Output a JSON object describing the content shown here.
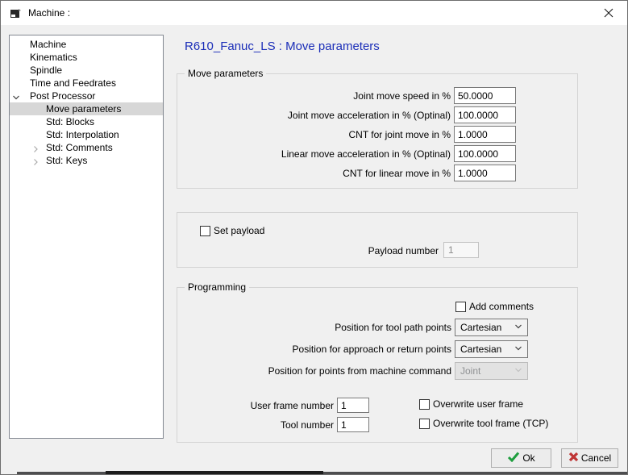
{
  "window": {
    "title": "Machine :",
    "icons": {
      "app": "machine-icon",
      "close": "close-icon"
    }
  },
  "sidebar": {
    "items": [
      {
        "label": "Machine",
        "level": 0,
        "chevron": "none",
        "selected": false
      },
      {
        "label": "Kinematics",
        "level": 0,
        "chevron": "none",
        "selected": false
      },
      {
        "label": "Spindle",
        "level": 0,
        "chevron": "none",
        "selected": false
      },
      {
        "label": "Time and Feedrates",
        "level": 0,
        "chevron": "none",
        "selected": false
      },
      {
        "label": "Post Processor",
        "level": 0,
        "chevron": "down",
        "selected": false
      },
      {
        "label": "Move parameters",
        "level": 1,
        "chevron": "none",
        "selected": true
      },
      {
        "label": "Std: Blocks",
        "level": 1,
        "chevron": "none",
        "selected": false
      },
      {
        "label": "Std: Interpolation",
        "level": 1,
        "chevron": "none",
        "selected": false
      },
      {
        "label": "Std: Comments",
        "level": 1,
        "chevron": "right",
        "selected": false
      },
      {
        "label": "Std: Keys",
        "level": 1,
        "chevron": "right",
        "selected": false
      }
    ]
  },
  "header": {
    "title": "R610_Fanuc_LS : Move parameters"
  },
  "move_parameters": {
    "title": "Move parameters",
    "fields": [
      {
        "label": "Joint move speed in %",
        "value": "50.0000"
      },
      {
        "label": "Joint move acceleration in % (Optinal)",
        "value": "100.0000"
      },
      {
        "label": "CNT for joint move in %",
        "value": "1.0000"
      },
      {
        "label": "Linear move acceleration in % (Optinal)",
        "value": "100.0000"
      },
      {
        "label": "CNT for linear move in %",
        "value": "1.0000"
      }
    ]
  },
  "payload": {
    "checkbox_label": "Set payload",
    "checkbox_checked": false,
    "number_label": "Payload number",
    "number_value": "1",
    "number_disabled": true
  },
  "programming": {
    "title": "Programming",
    "add_comments_label": "Add comments",
    "add_comments_checked": false,
    "selects": [
      {
        "label": "Position for tool path points",
        "value": "Cartesian",
        "disabled": false
      },
      {
        "label": "Position for approach or return points",
        "value": "Cartesian",
        "disabled": false
      },
      {
        "label": "Position for points from machine command",
        "value": "Joint",
        "disabled": true
      }
    ],
    "user_frame": {
      "label": "User frame number",
      "value": "1"
    },
    "tool_number": {
      "label": "Tool number",
      "value": "1"
    },
    "overwrite_user_label": "Overwrite user frame",
    "overwrite_user_checked": false,
    "overwrite_tool_label": "Overwrite tool frame (TCP)",
    "overwrite_tool_checked": false
  },
  "footer": {
    "ok_label": "Ok",
    "cancel_label": "Cancel",
    "icons": {
      "ok": "check-icon",
      "cancel": "cross-icon"
    }
  },
  "colors": {
    "header_blue": "#1b2eb8",
    "ok_green": "#1e9e3e",
    "cancel_red": "#bf3434",
    "selected_row": "#d7d7d7"
  }
}
